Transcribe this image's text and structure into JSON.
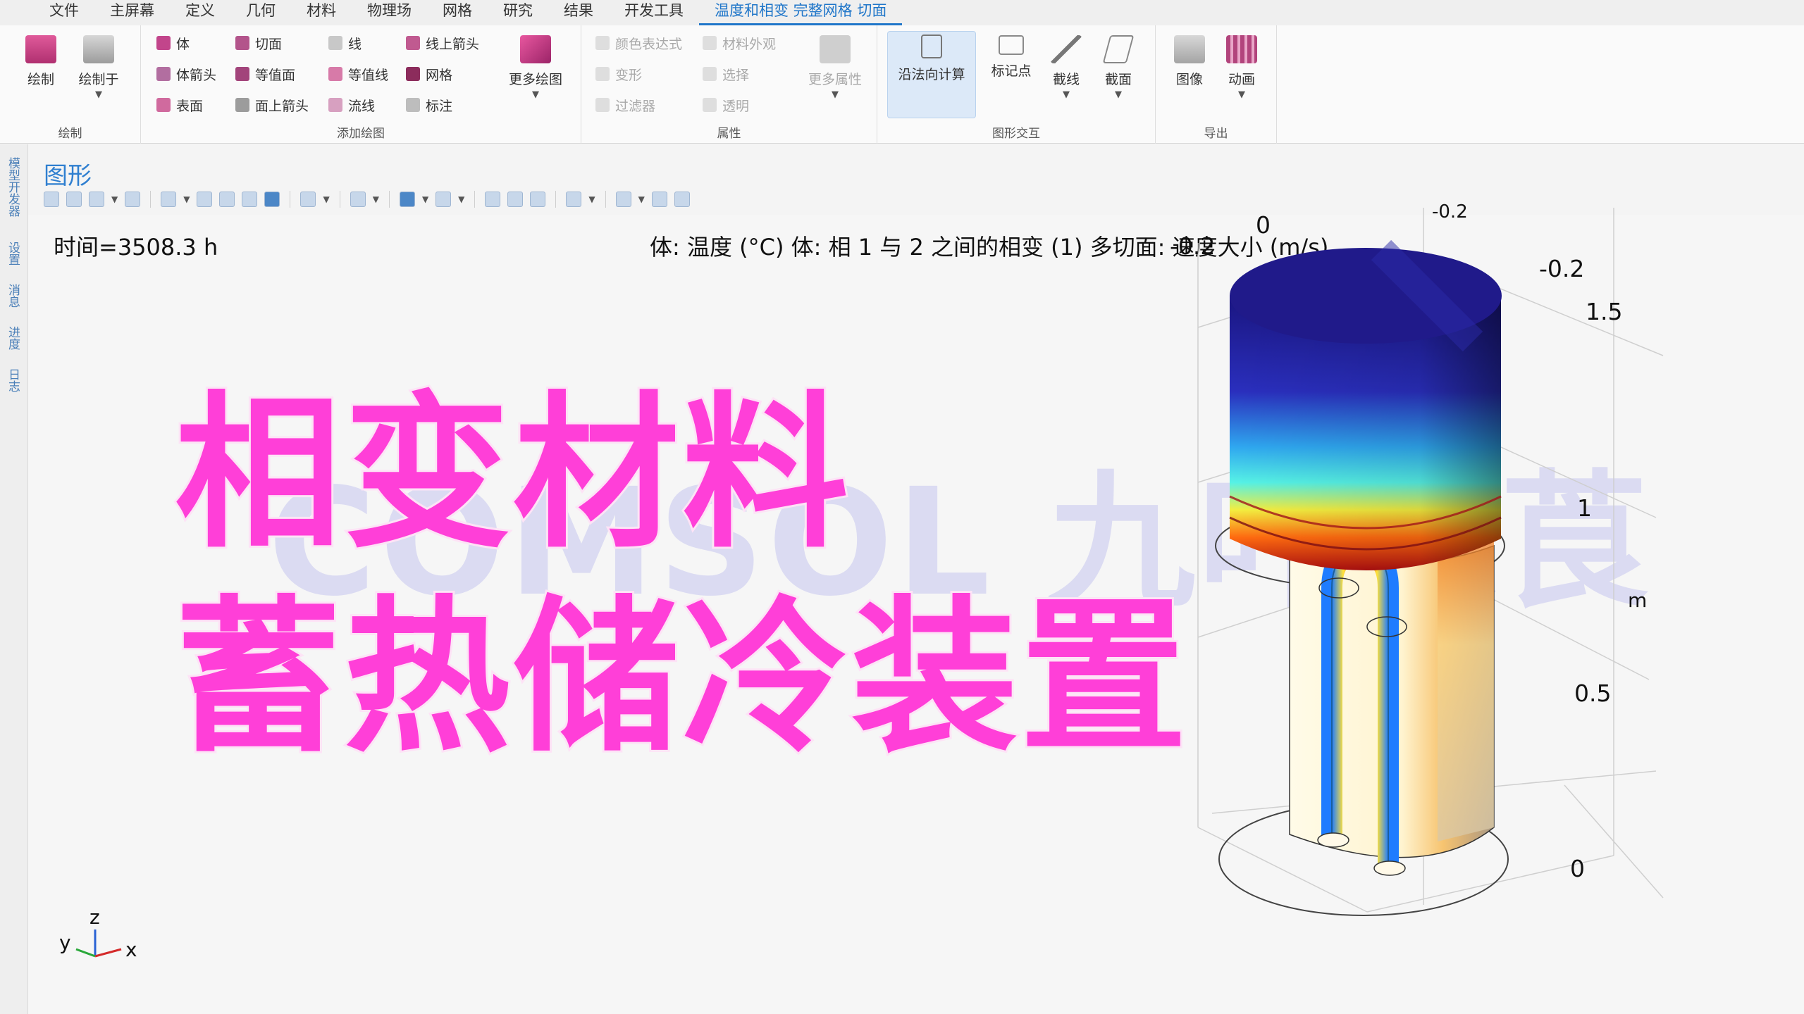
{
  "menubar": {
    "items": [
      "文件",
      "主屏幕",
      "定义",
      "几何",
      "材料",
      "物理场",
      "网格",
      "研究",
      "结果",
      "开发工具",
      "温度和相变 完整网格 切面"
    ]
  },
  "ribbon": {
    "groups": {
      "draw": {
        "label": "绘制",
        "draw": "绘制",
        "draw_in": "绘制于"
      },
      "add_plot": {
        "label": "添加绘图",
        "col1": [
          "体",
          "体箭头",
          "表面"
        ],
        "col2": [
          "切面",
          "等值面",
          "面上箭头"
        ],
        "col3": [
          "线",
          "等值线",
          "流线"
        ],
        "col4": [
          "线上箭头",
          "网格",
          "标注"
        ],
        "more": "更多绘图"
      },
      "attributes": {
        "label": "属性",
        "col1": [
          "颜色表达式",
          "变形",
          "过滤器"
        ],
        "col2": [
          "材料外观",
          "选择",
          "透明"
        ],
        "more": "更多属性"
      },
      "interaction": {
        "label": "图形交互",
        "normal_calc": "沿法向计算",
        "mark_point": "标记点",
        "cut_line": "截线",
        "cut_plane": "截面"
      },
      "export": {
        "label": "导出",
        "image": "图像",
        "animation": "动画"
      }
    }
  },
  "left_strip": {
    "tabs": [
      "模型开发器",
      "设置",
      "消息",
      "进度",
      "日志"
    ]
  },
  "graphics": {
    "title": "图形",
    "time": "时间=3508.3 h",
    "description": "体: 温度 (°C)  体: 相 1 与 2 之间的相变 (1)  多切面: 速度大小 (m/s)",
    "axis_labels": {
      "top_zero": "0",
      "top_neg02": "-0.2",
      "top_cut": "-0.2",
      "right_neg02": "-0.2",
      "z_15": "1.5",
      "z_1": "1",
      "unit": "m",
      "z_05": "0.5",
      "z_0": "0"
    },
    "triad": {
      "z": "z",
      "y": "y",
      "x": "x"
    }
  },
  "overlay": {
    "watermark": "COMSOL 九叶菜莨",
    "title_line_1": "相变材料",
    "title_line_2": "蓄热储冷装置"
  },
  "colors": {
    "accent": "#1f76c9",
    "title_magenta": "#ff3fd8"
  }
}
